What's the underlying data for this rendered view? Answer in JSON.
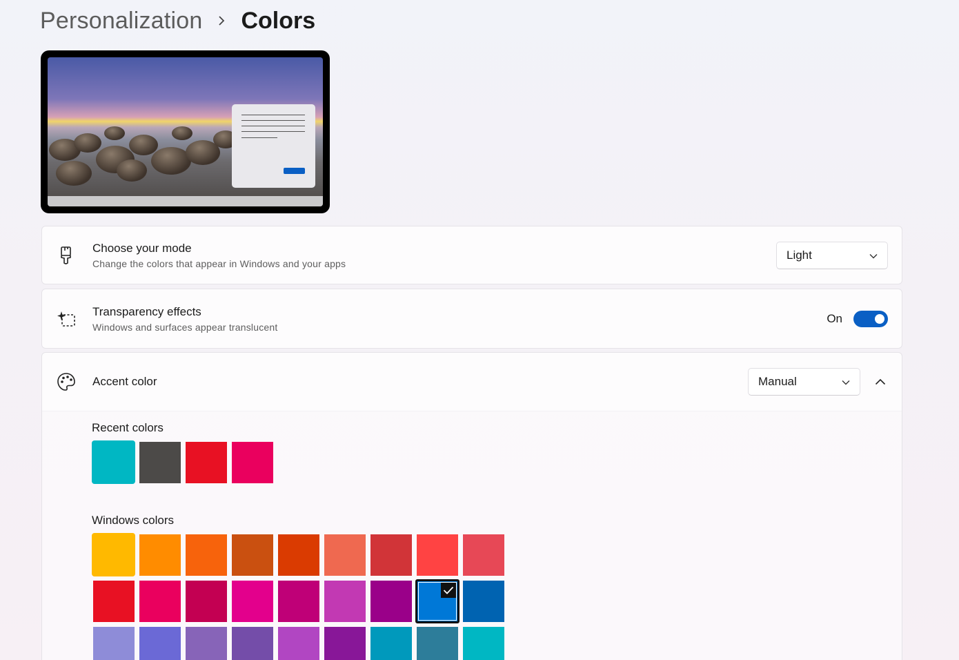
{
  "breadcrumb": {
    "parent": "Personalization",
    "current": "Colors"
  },
  "mode": {
    "title": "Choose your mode",
    "subtitle": "Change the colors that appear in Windows and your apps",
    "value": "Light",
    "icon": "paintbrush-icon"
  },
  "transparency": {
    "title": "Transparency effects",
    "subtitle": "Windows and surfaces appear translucent",
    "state_label": "On",
    "enabled": true,
    "icon": "transparency-icon"
  },
  "accent": {
    "title": "Accent color",
    "value": "Manual",
    "expanded": true,
    "icon": "palette-icon",
    "recent_label": "Recent colors",
    "recent_colors": [
      "#00b7c3",
      "#4c4a48",
      "#e81123",
      "#ea005e"
    ],
    "windows_label": "Windows colors",
    "windows_colors": [
      [
        "#ffb900",
        "#ff8c00",
        "#f7630c",
        "#ca5010",
        "#da3b01",
        "#ef6950",
        "#d13438",
        "#ff4343",
        "#e74856"
      ],
      [
        "#e81123",
        "#ea005e",
        "#c30052",
        "#e3008c",
        "#bf0077",
        "#c239b3",
        "#9a0089",
        "#0078d7",
        "#0063b1"
      ],
      [
        "#8e8cd8",
        "#6b69d6",
        "#8764b8",
        "#744da9",
        "#b146c2",
        "#881798",
        "#0099bc",
        "#2d7d9a",
        "#00b7c3"
      ]
    ],
    "selected_color": "#0078d7"
  }
}
